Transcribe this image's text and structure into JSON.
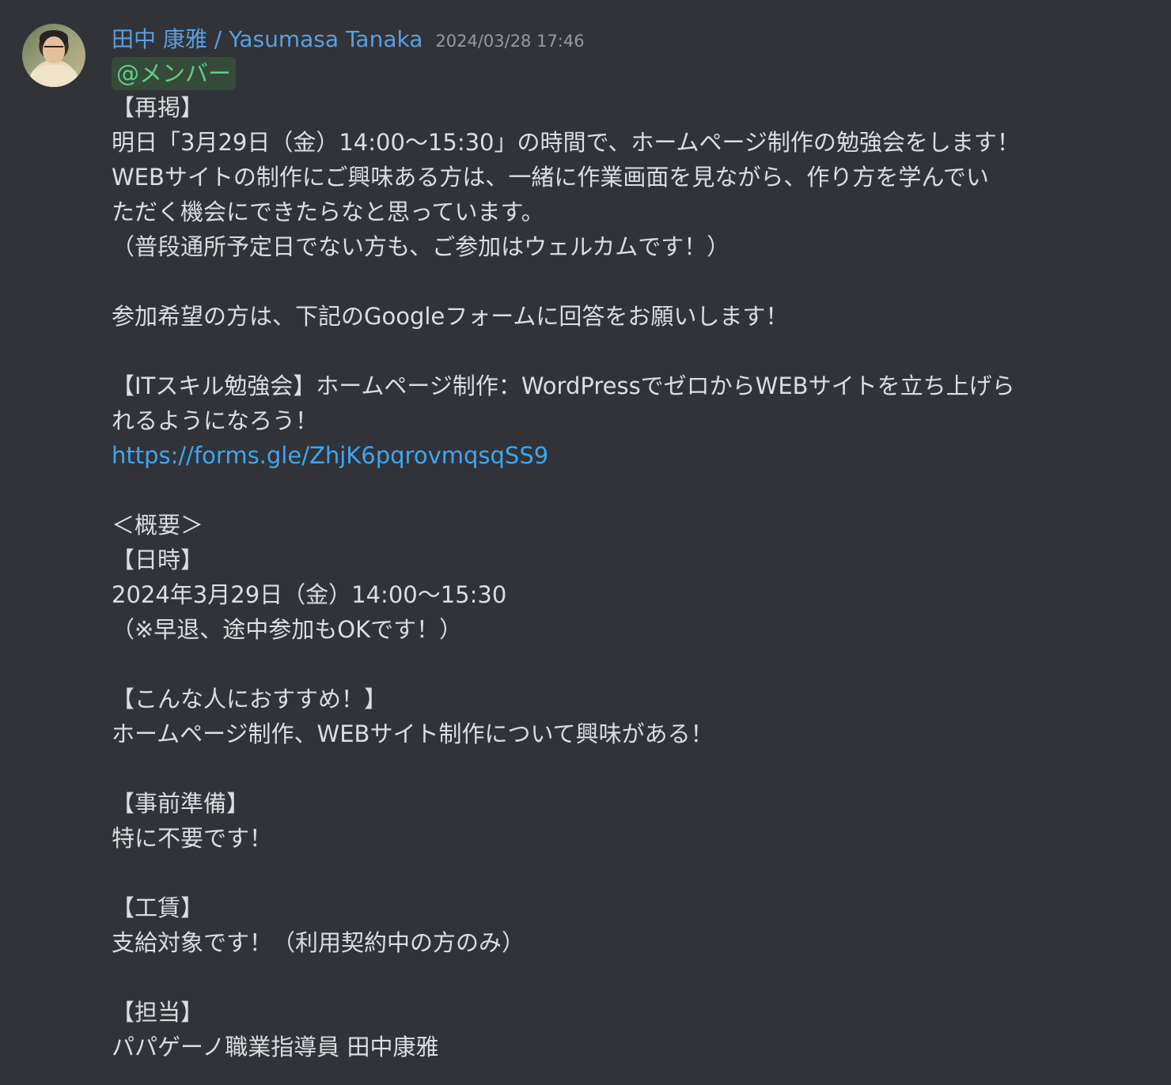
{
  "message": {
    "author": "田中 康雅 / Yasumasa Tanaka",
    "timestamp": "2024/03/28 17:46",
    "mention": "@メンバー",
    "lines": [
      "【再掲】",
      "明日「3月29日（金）14:00〜15:30」の時間で、ホームページ制作の勉強会をします！",
      "WEBサイトの制作にご興味ある方は、一緒に作業画面を見ながら、作り方を学んでい",
      "ただく機会にできたらなと思っています。",
      "（普段通所予定日でない方も、ご参加はウェルカムです！）",
      "",
      "参加希望の方は、下記のGoogleフォームに回答をお願いします！",
      "",
      "【ITスキル勉強会】ホームページ制作：WordPressでゼロからWEBサイトを立ち上げら",
      "れるようになろう！"
    ],
    "link": "https://forms.gle/ZhjK6pqrovmqsqSS9",
    "lines_after_link": [
      "",
      "＜概要＞",
      "【日時】",
      "2024年3月29日（金）14:00〜15:30",
      "（※早退、途中参加もOKです！）",
      "",
      "【こんな人におすすめ！】",
      "ホームページ制作、WEBサイト制作について興味がある！",
      "",
      "【事前準備】",
      "特に不要です！",
      "",
      "【工賃】",
      "支給対象です！（利用契約中の方のみ）",
      "",
      "【担当】",
      "パパゲーノ職業指導員 田中康雅"
    ]
  },
  "colors": {
    "background": "#313338",
    "author": "#5b9fe0",
    "timestamp": "#949ba4",
    "text": "#dbdee1",
    "mention_text": "#5fcf84",
    "mention_bg": "#364a3a",
    "link": "#3ea6f2"
  }
}
